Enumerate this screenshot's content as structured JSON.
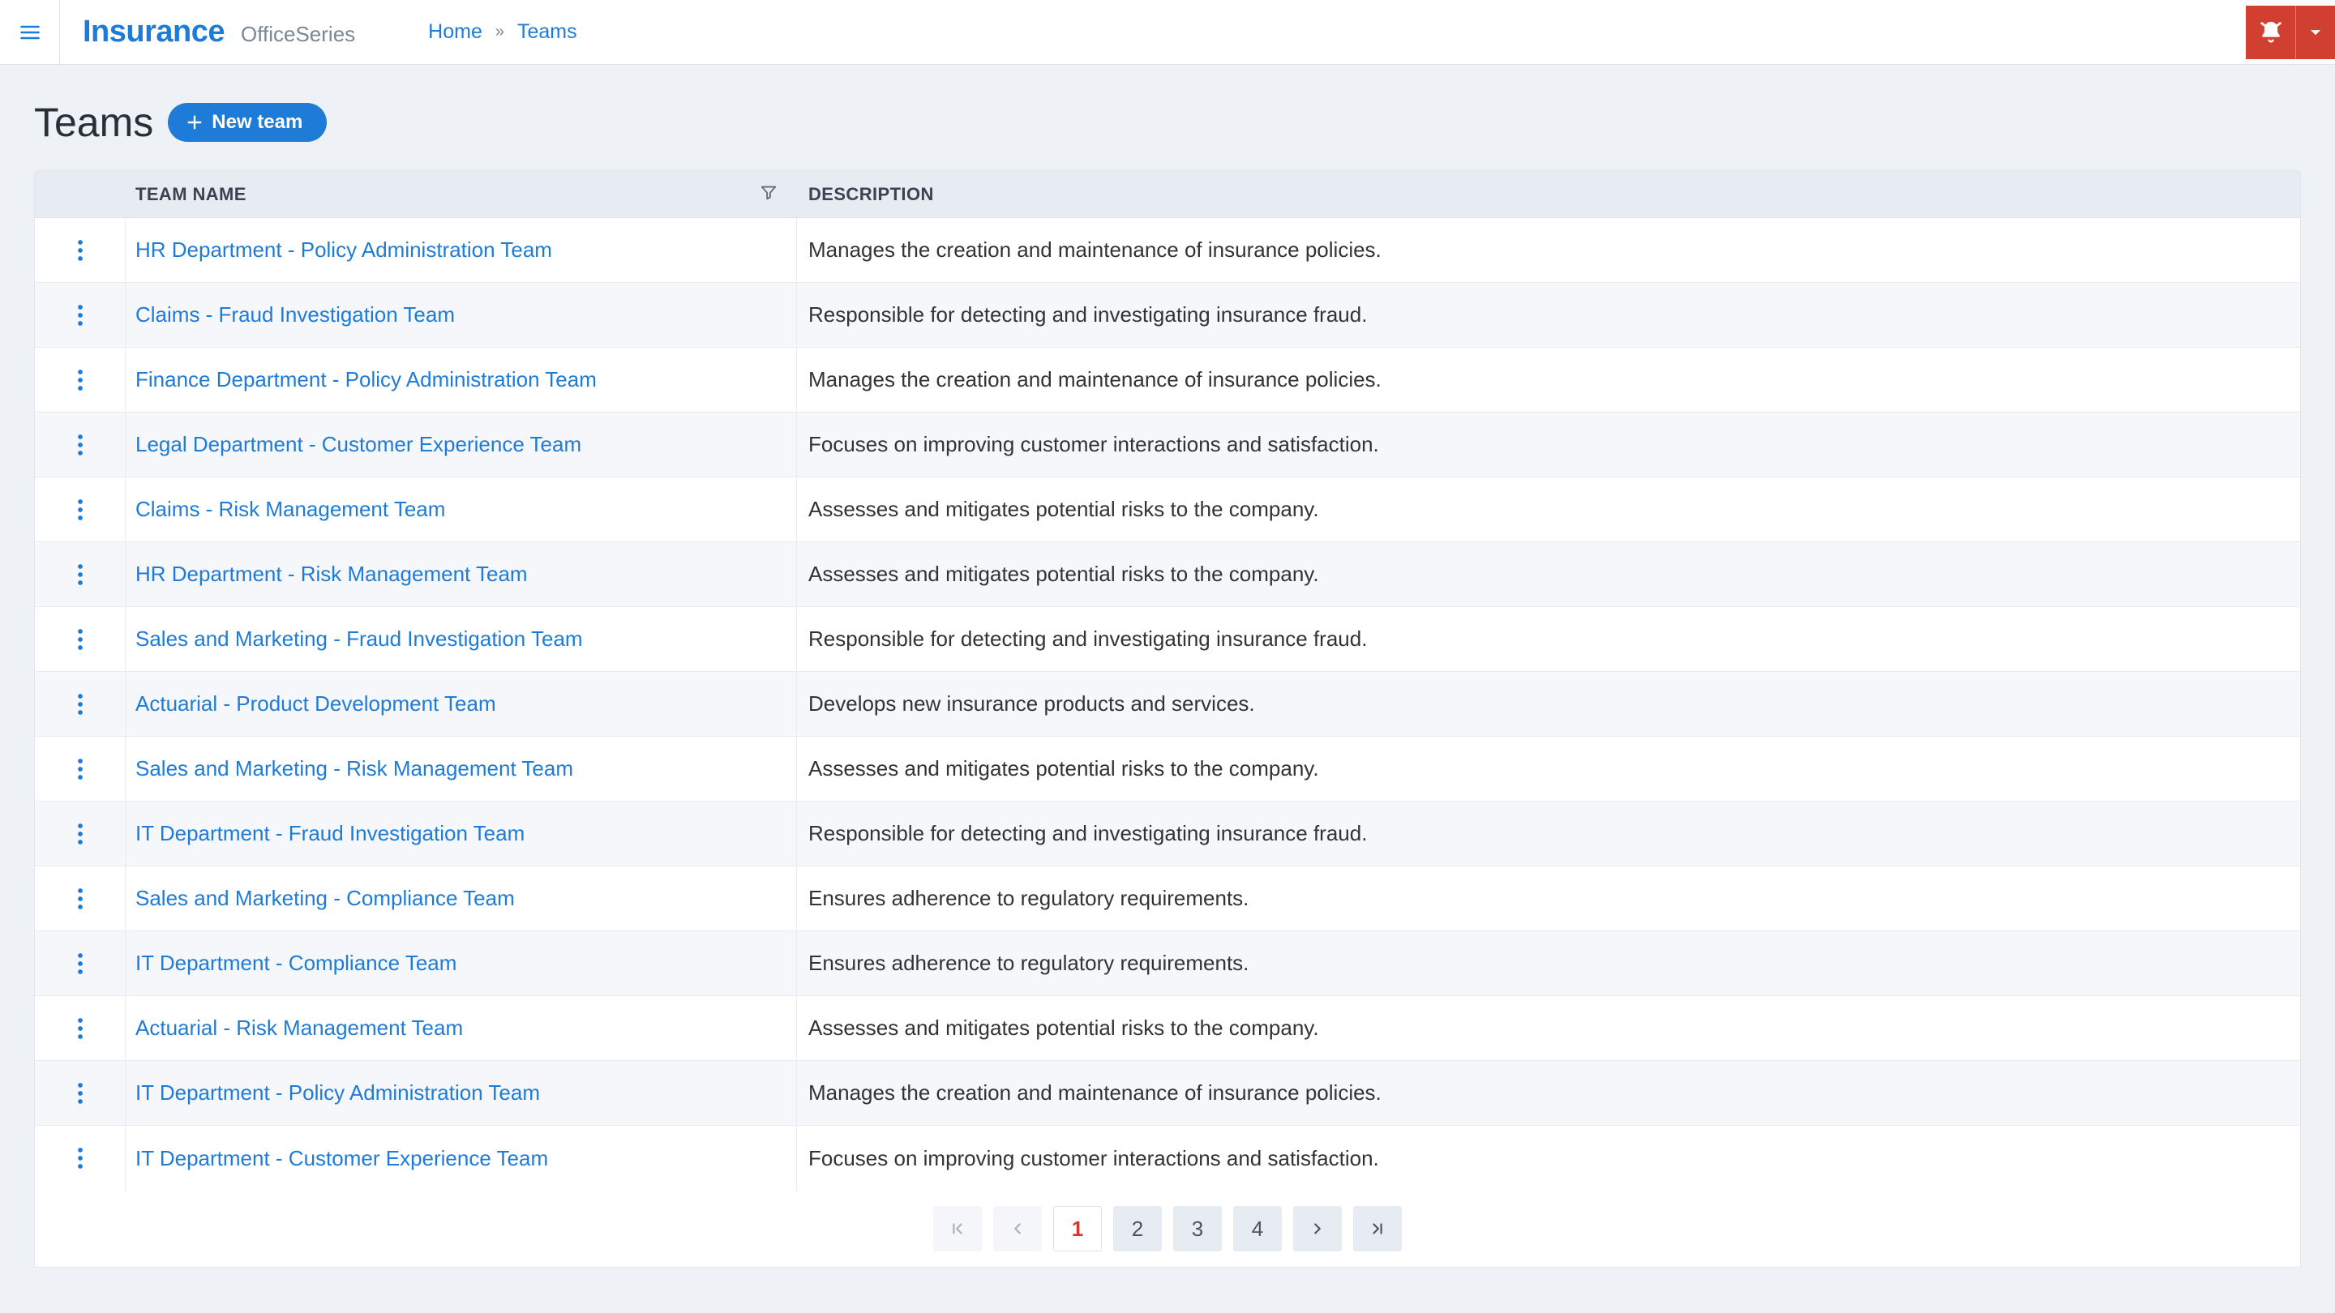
{
  "brand": {
    "name": "Insurance",
    "sub": "OfficeSeries"
  },
  "breadcrumb": {
    "home": "Home",
    "current": "Teams"
  },
  "page": {
    "title": "Teams",
    "new_btn": "New team"
  },
  "table": {
    "headers": {
      "name": "TEAM NAME",
      "desc": "DESCRIPTION"
    },
    "rows": [
      {
        "name": "HR Department - Policy Administration Team",
        "desc": "Manages the creation and maintenance of insurance policies."
      },
      {
        "name": "Claims - Fraud Investigation Team",
        "desc": "Responsible for detecting and investigating insurance fraud."
      },
      {
        "name": "Finance Department - Policy Administration Team",
        "desc": "Manages the creation and maintenance of insurance policies."
      },
      {
        "name": "Legal Department - Customer Experience Team",
        "desc": "Focuses on improving customer interactions and satisfaction."
      },
      {
        "name": "Claims - Risk Management Team",
        "desc": "Assesses and mitigates potential risks to the company."
      },
      {
        "name": "HR Department - Risk Management Team",
        "desc": "Assesses and mitigates potential risks to the company."
      },
      {
        "name": "Sales and Marketing - Fraud Investigation Team",
        "desc": "Responsible for detecting and investigating insurance fraud."
      },
      {
        "name": "Actuarial - Product Development Team",
        "desc": "Develops new insurance products and services."
      },
      {
        "name": "Sales and Marketing - Risk Management Team",
        "desc": "Assesses and mitigates potential risks to the company."
      },
      {
        "name": "IT Department - Fraud Investigation Team",
        "desc": "Responsible for detecting and investigating insurance fraud."
      },
      {
        "name": "Sales and Marketing - Compliance Team",
        "desc": "Ensures adherence to regulatory requirements."
      },
      {
        "name": "IT Department - Compliance Team",
        "desc": "Ensures adherence to regulatory requirements."
      },
      {
        "name": "Actuarial - Risk Management Team",
        "desc": "Assesses and mitigates potential risks to the company."
      },
      {
        "name": "IT Department - Policy Administration Team",
        "desc": "Manages the creation and maintenance of insurance policies."
      },
      {
        "name": "IT Department - Customer Experience Team",
        "desc": "Focuses on improving customer interactions and satisfaction."
      }
    ]
  },
  "pager": {
    "pages": [
      "1",
      "2",
      "3",
      "4"
    ],
    "current": "1"
  }
}
